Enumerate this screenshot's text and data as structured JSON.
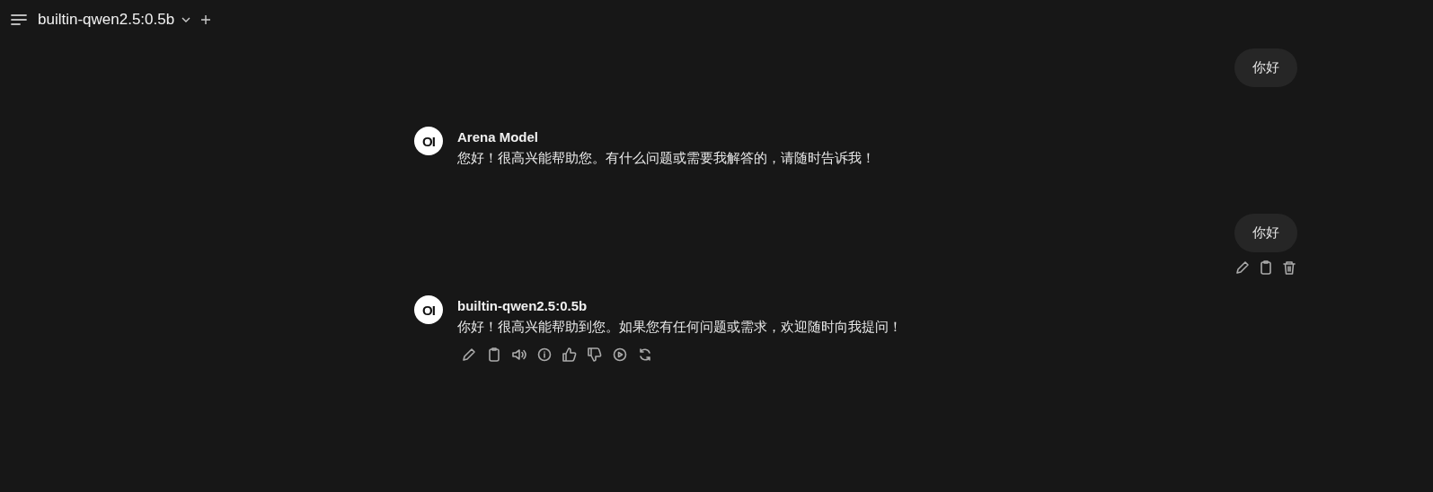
{
  "header": {
    "model": "builtin-qwen2.5:0.5b"
  },
  "messages": [
    {
      "kind": "user",
      "text": "你好"
    },
    {
      "kind": "assistant",
      "logo": "OI",
      "name": "Arena Model",
      "text": "您好！很高兴能帮助您。有什么问题或需要我解答的，请随时告诉我！"
    },
    {
      "kind": "user",
      "text": "你好",
      "actions": [
        {
          "kind": "edit"
        },
        {
          "kind": "copy"
        },
        {
          "kind": "delete"
        }
      ]
    },
    {
      "kind": "assistant",
      "logo": "OI",
      "name": "builtin-qwen2.5:0.5b",
      "text": "你好！很高兴能帮助到您。如果您有任何问题或需求，欢迎随时向我提问！",
      "actions": [
        {
          "kind": "edit"
        },
        {
          "kind": "copy"
        },
        {
          "kind": "speak"
        },
        {
          "kind": "info"
        },
        {
          "kind": "like"
        },
        {
          "kind": "dislike"
        },
        {
          "kind": "continue"
        },
        {
          "kind": "regenerate"
        }
      ]
    }
  ]
}
